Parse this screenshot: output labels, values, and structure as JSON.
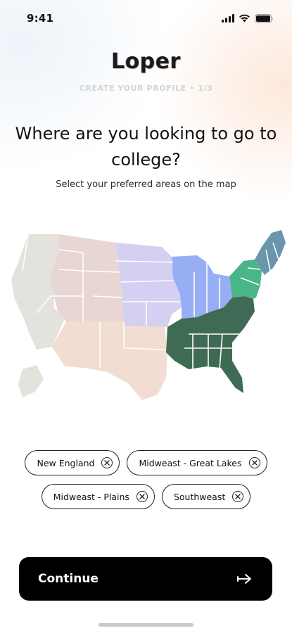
{
  "status_bar": {
    "time": "9:41"
  },
  "brand": {
    "logo": "Loper"
  },
  "onboarding": {
    "step_label": "CREATE YOUR PROFILE • 1/3",
    "title": "Where are you looking to go to college?",
    "subtitle": "Select your preferred areas on the map"
  },
  "map": {
    "regions": [
      {
        "name": "Pacific / West",
        "selected": false,
        "color": "#e4e2dc"
      },
      {
        "name": "Mountain",
        "selected": false,
        "color": "#e8d6d4"
      },
      {
        "name": "Southwest",
        "selected": false,
        "color": "#f1ddd2"
      },
      {
        "name": "Midwest - Plains",
        "selected": true,
        "color": "#d4d0f2"
      },
      {
        "name": "Midwest - Great Lakes",
        "selected": true,
        "color": "#97aef4"
      },
      {
        "name": "Southeast",
        "selected": true,
        "color": "#3f6a54"
      },
      {
        "name": "Mid-Atlantic",
        "selected": true,
        "color": "#48b687"
      },
      {
        "name": "New England",
        "selected": true,
        "color": "#6b94ad"
      }
    ]
  },
  "selected_regions": [
    [
      "New England",
      "Midweast - Great Lakes"
    ],
    [
      "Midweast - Plains",
      "Southweast"
    ]
  ],
  "chip_remove_icon": "close-circle-icon",
  "actions": {
    "continue_label": "Continue",
    "continue_icon": "arrow-right-icon"
  }
}
